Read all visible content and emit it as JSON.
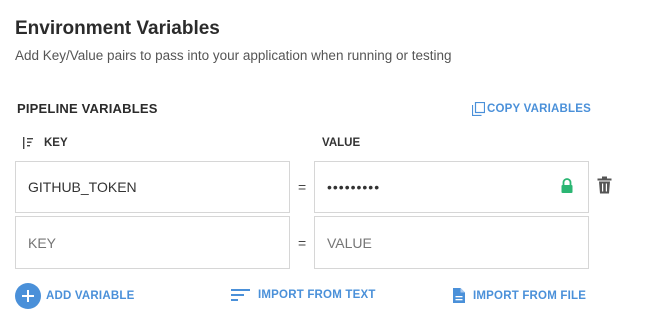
{
  "header": {
    "title": "Environment Variables",
    "subtitle": "Add Key/Value pairs to pass into your application when running or testing"
  },
  "pipeline": {
    "heading": "PIPELINE VARIABLES",
    "copy_label": "COPY VARIABLES",
    "key_column": "KEY",
    "value_column": "VALUE",
    "equals": "=",
    "rows": [
      {
        "key": "GITHUB_TOKEN",
        "value": "•••••••••",
        "protected": true
      }
    ],
    "new_row": {
      "key_placeholder": "KEY",
      "value_placeholder": "VALUE"
    }
  },
  "actions": {
    "add_variable": "ADD VARIABLE",
    "import_text": "IMPORT FROM TEXT",
    "import_file": "IMPORT FROM FILE"
  },
  "colors": {
    "accent": "#4a90d9",
    "lock": "#2bb673"
  },
  "icons": {
    "copy": "copy-icon",
    "sort": "sort-icon",
    "lock": "lock-icon",
    "delete": "trash-icon",
    "add": "plus-icon",
    "text": "text-lines-icon",
    "file": "file-icon"
  }
}
